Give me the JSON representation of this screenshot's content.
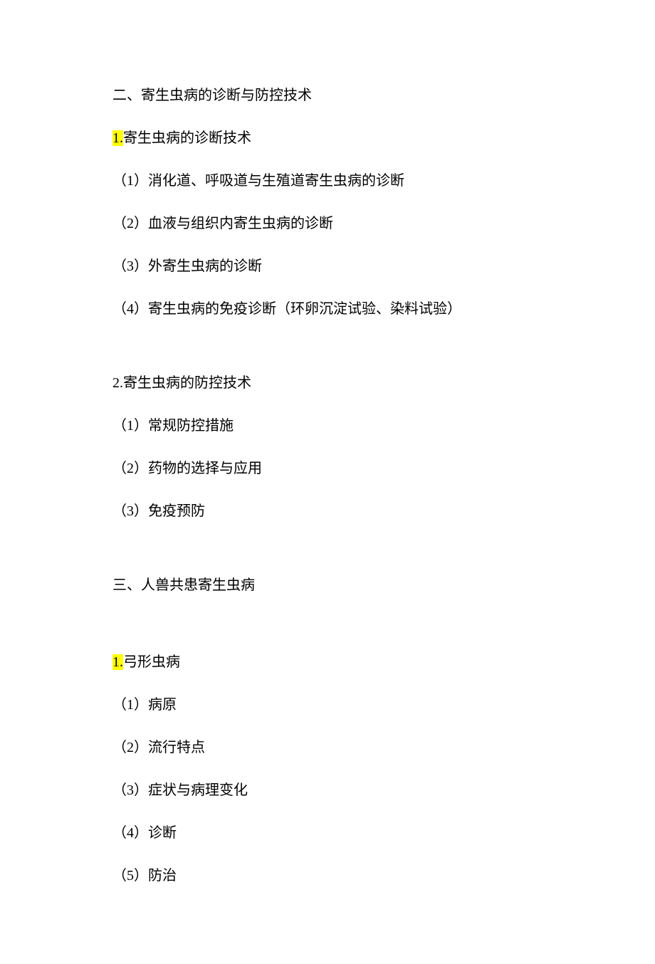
{
  "section2": {
    "title": "二、寄生虫病的诊断与防控技术",
    "sub1": {
      "highlighted": "1.",
      "heading_rest": "寄生虫病的诊断技术",
      "items": [
        "（1）消化道、呼吸道与生殖道寄生虫病的诊断",
        "（2）血液与组织内寄生虫病的诊断",
        "（3）外寄生虫病的诊断",
        "（4）寄生虫病的免疫诊断（环卵沉淀试验、染料试验）"
      ]
    },
    "sub2": {
      "heading": "2.寄生虫病的防控技术",
      "items": [
        "（1）常规防控措施",
        "（2）药物的选择与应用",
        "（3）免疫预防"
      ]
    }
  },
  "section3": {
    "title": "三、人兽共患寄生虫病",
    "sub1": {
      "highlighted": "1.",
      "heading_rest": "弓形虫病",
      "items": [
        "（1）病原",
        "（2）流行特点",
        "（3）症状与病理变化",
        "（4）诊断",
        "（5）防治"
      ]
    }
  }
}
